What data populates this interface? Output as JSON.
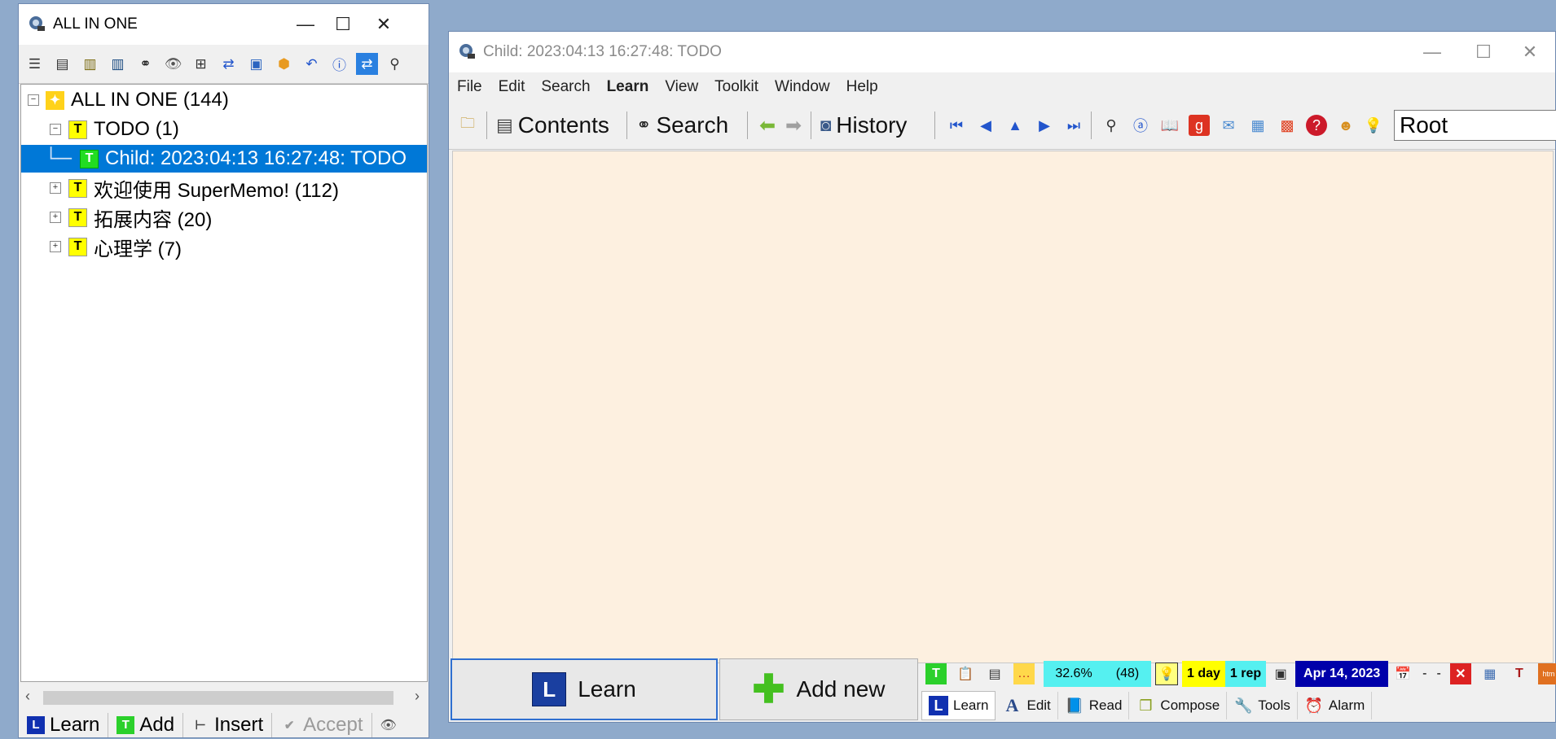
{
  "left_window": {
    "title": "ALL IN ONE",
    "controls": {
      "minimize": "—",
      "maximize": "☐",
      "close": "✕"
    },
    "toolbar_icons": [
      "list-icon",
      "document-icon",
      "books-icon",
      "books-blue-icon",
      "binoculars-icon",
      "eye-icon",
      "tree-icon",
      "transfer-icon",
      "save-icon",
      "gear-badge-icon",
      "undo-icon",
      "info-icon",
      "sync-icon",
      "search-icon"
    ],
    "tree": [
      {
        "label": "ALL IN ONE (144)",
        "level": 0,
        "icon": "bulb-icon",
        "expanded": true
      },
      {
        "label": "TODO (1)",
        "level": 1,
        "icon": "topic-icon",
        "expanded": true
      },
      {
        "label": "Child: 2023:04:13 16:27:48: TODO",
        "level": 2,
        "icon": "topic-green-icon",
        "selected": true
      },
      {
        "label": "欢迎使用 SuperMemo!   (112)",
        "level": 1,
        "icon": "topic-icon",
        "expanded": false
      },
      {
        "label": "拓展内容 (20)",
        "level": 1,
        "icon": "topic-icon",
        "expanded": false
      },
      {
        "label": "心理学 (7)",
        "level": 1,
        "icon": "topic-icon",
        "expanded": false
      }
    ],
    "bottom_buttons": {
      "learn": "Learn",
      "add": "Add",
      "insert": "Insert",
      "accept": "Accept"
    }
  },
  "right_window": {
    "title": "Child: 2023:04:13 16:27:48: TODO",
    "controls": {
      "minimize": "—",
      "maximize": "☐",
      "close": "✕"
    },
    "menu": [
      "File",
      "Edit",
      "Search",
      "Learn",
      "View",
      "Toolkit",
      "Window",
      "Help"
    ],
    "toolbar": {
      "contents": "Contents",
      "search": "Search",
      "history": "History",
      "root_field": "Root"
    },
    "buttons": {
      "learn": "Learn",
      "add_new": "Add new"
    },
    "status": {
      "percent": "32.6%",
      "count": "(48)",
      "interval": "1 day",
      "reps": "1 rep",
      "date": "Apr 14, 2023",
      "dash1": "-",
      "dash2": "-"
    },
    "tabs": [
      "Learn",
      "Edit",
      "Read",
      "Compose",
      "Tools",
      "Alarm"
    ]
  },
  "colors": {
    "desktop": "#8faacb",
    "content_bg": "#fdf0e0",
    "selection": "#0078d7",
    "status_cyan": "#55f0f0",
    "status_yellow": "#ffff00",
    "status_date": "#0000aa"
  }
}
